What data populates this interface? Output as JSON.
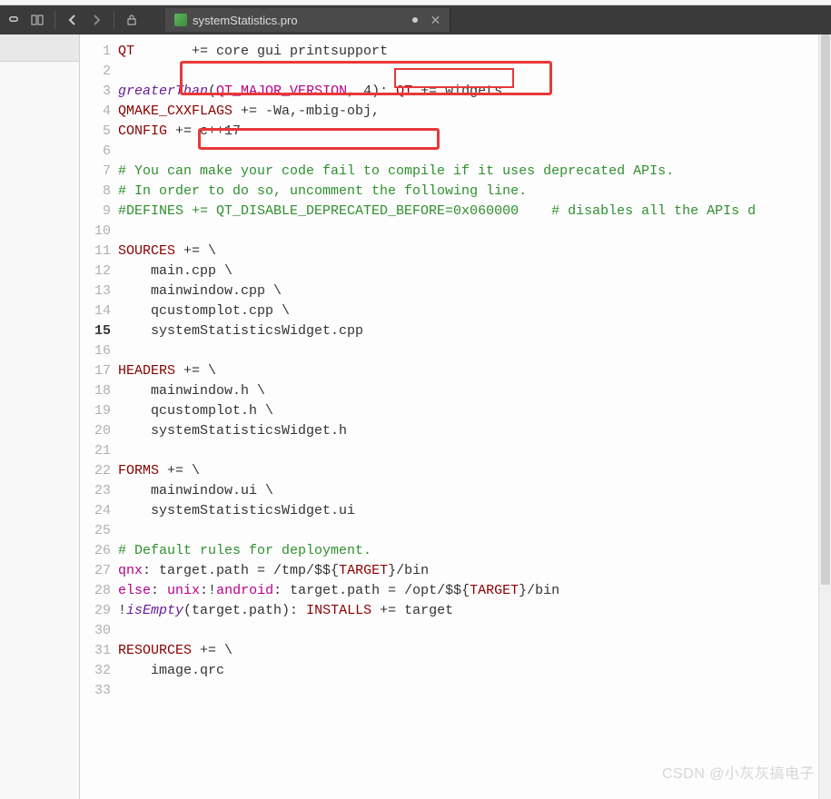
{
  "tab": {
    "filename": "systemStatistics.pro"
  },
  "watermark": "CSDN @小灰灰搞电子",
  "code": {
    "lines": [
      {
        "n": 1,
        "segs": [
          {
            "t": "QT",
            "c": "tok-var"
          },
          {
            "t": "       += core gui ",
            "c": "tok-plain"
          },
          {
            "t": "printsupport",
            "c": "tok-plain"
          }
        ]
      },
      {
        "n": 2,
        "segs": []
      },
      {
        "n": 3,
        "segs": [
          {
            "t": "greaterThan",
            "c": "tok-func"
          },
          {
            "t": "(",
            "c": "tok-plain"
          },
          {
            "t": "QT_MAJOR_VERSION",
            "c": "tok-macro"
          },
          {
            "t": ", 4): ",
            "c": "tok-plain"
          },
          {
            "t": "QT",
            "c": "tok-var"
          },
          {
            "t": " += widgets",
            "c": "tok-plain"
          }
        ]
      },
      {
        "n": 4,
        "segs": [
          {
            "t": "QMAKE_CXXFLAGS",
            "c": "tok-var"
          },
          {
            "t": " += -Wa,-mbig-obj,",
            "c": "tok-plain"
          }
        ]
      },
      {
        "n": 5,
        "segs": [
          {
            "t": "CONFIG",
            "c": "tok-var"
          },
          {
            "t": " += c++17",
            "c": "tok-plain"
          }
        ]
      },
      {
        "n": 6,
        "segs": []
      },
      {
        "n": 7,
        "segs": [
          {
            "t": "# You can make your code fail to compile if it uses deprecated APIs.",
            "c": "tok-comment"
          }
        ]
      },
      {
        "n": 8,
        "segs": [
          {
            "t": "# In order to do so, uncomment the following line.",
            "c": "tok-comment"
          }
        ]
      },
      {
        "n": 9,
        "segs": [
          {
            "t": "#DEFINES += QT_DISABLE_DEPRECATED_BEFORE=0x060000    # disables all the APIs d",
            "c": "tok-comment"
          }
        ]
      },
      {
        "n": 10,
        "segs": []
      },
      {
        "n": 11,
        "segs": [
          {
            "t": "SOURCES",
            "c": "tok-var"
          },
          {
            "t": " += \\",
            "c": "tok-plain"
          }
        ]
      },
      {
        "n": 12,
        "segs": [
          {
            "t": "    main.cpp \\",
            "c": "tok-plain"
          }
        ]
      },
      {
        "n": 13,
        "segs": [
          {
            "t": "    mainwindow.cpp \\",
            "c": "tok-plain"
          }
        ]
      },
      {
        "n": 14,
        "segs": [
          {
            "t": "    qcustomplot.cpp \\",
            "c": "tok-plain"
          }
        ]
      },
      {
        "n": 15,
        "current": true,
        "segs": [
          {
            "t": "    systemStatisticsWidget.cpp",
            "c": "tok-plain"
          }
        ]
      },
      {
        "n": 16,
        "segs": []
      },
      {
        "n": 17,
        "segs": [
          {
            "t": "HEADERS",
            "c": "tok-var"
          },
          {
            "t": " += \\",
            "c": "tok-plain"
          }
        ]
      },
      {
        "n": 18,
        "segs": [
          {
            "t": "    mainwindow.h \\",
            "c": "tok-plain"
          }
        ]
      },
      {
        "n": 19,
        "segs": [
          {
            "t": "    qcustomplot.h \\",
            "c": "tok-plain"
          }
        ]
      },
      {
        "n": 20,
        "segs": [
          {
            "t": "    systemStatisticsWidget.h",
            "c": "tok-plain"
          }
        ]
      },
      {
        "n": 21,
        "segs": []
      },
      {
        "n": 22,
        "segs": [
          {
            "t": "FORMS",
            "c": "tok-var"
          },
          {
            "t": " += \\",
            "c": "tok-plain"
          }
        ]
      },
      {
        "n": 23,
        "segs": [
          {
            "t": "    mainwindow.ui \\",
            "c": "tok-plain"
          }
        ]
      },
      {
        "n": 24,
        "segs": [
          {
            "t": "    systemStatisticsWidget.ui",
            "c": "tok-plain"
          }
        ]
      },
      {
        "n": 25,
        "segs": []
      },
      {
        "n": 26,
        "segs": [
          {
            "t": "# Default rules for deployment.",
            "c": "tok-comment"
          }
        ]
      },
      {
        "n": 27,
        "segs": [
          {
            "t": "qnx",
            "c": "tok-key"
          },
          {
            "t": ": target.path = /tmp/$${",
            "c": "tok-plain"
          },
          {
            "t": "TARGET",
            "c": "tok-var"
          },
          {
            "t": "}/bin",
            "c": "tok-plain"
          }
        ]
      },
      {
        "n": 28,
        "segs": [
          {
            "t": "else",
            "c": "tok-key"
          },
          {
            "t": ": ",
            "c": "tok-plain"
          },
          {
            "t": "unix",
            "c": "tok-key"
          },
          {
            "t": ":!",
            "c": "tok-plain"
          },
          {
            "t": "android",
            "c": "tok-key"
          },
          {
            "t": ": target.path = /opt/$${",
            "c": "tok-plain"
          },
          {
            "t": "TARGET",
            "c": "tok-var"
          },
          {
            "t": "}/bin",
            "c": "tok-plain"
          }
        ]
      },
      {
        "n": 29,
        "segs": [
          {
            "t": "!",
            "c": "tok-plain"
          },
          {
            "t": "isEmpty",
            "c": "tok-func"
          },
          {
            "t": "(target.path): ",
            "c": "tok-plain"
          },
          {
            "t": "INSTALLS",
            "c": "tok-var"
          },
          {
            "t": " += target",
            "c": "tok-plain"
          }
        ]
      },
      {
        "n": 30,
        "segs": []
      },
      {
        "n": 31,
        "segs": [
          {
            "t": "RESOURCES",
            "c": "tok-var"
          },
          {
            "t": " += \\",
            "c": "tok-plain"
          }
        ]
      },
      {
        "n": 32,
        "segs": [
          {
            "t": "    image.qrc",
            "c": "tok-plain"
          }
        ]
      },
      {
        "n": 33,
        "segs": []
      }
    ]
  }
}
